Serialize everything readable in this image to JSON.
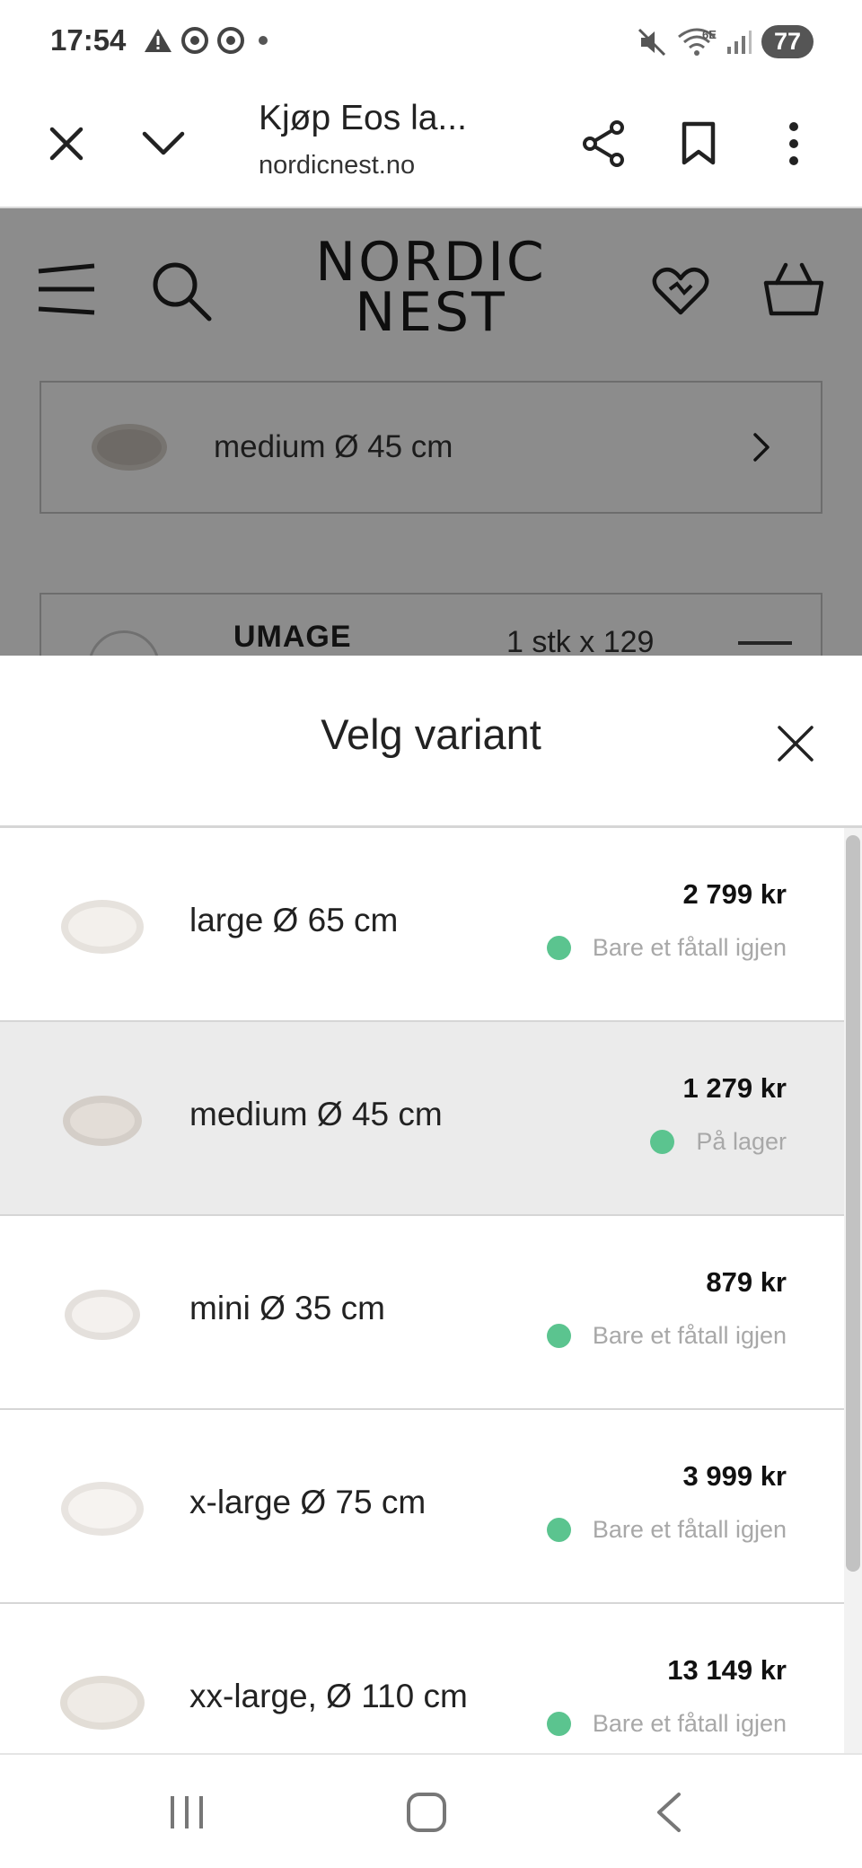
{
  "status_bar": {
    "time": "17:54",
    "battery": "77",
    "left_icons": [
      "warning-icon",
      "chrome-icon",
      "chrome-icon",
      "dot-icon"
    ],
    "right_icons": [
      "mute-icon",
      "wifi-icon",
      "signal-icon"
    ],
    "wifi_label": "6E"
  },
  "browser": {
    "tab_title": "Kjøp Eos la...",
    "url": "nordicnest.no",
    "icons": [
      "close-icon",
      "chevron-down-icon",
      "share-icon",
      "bookmark-icon",
      "more-vertical-icon"
    ]
  },
  "site": {
    "logo_line1": "NORDIC",
    "logo_line2": "NEST",
    "icons": [
      "menu-icon",
      "search-icon",
      "heart-icon",
      "basket-icon"
    ],
    "selected_variant": "medium Ø 45 cm",
    "cart_item": {
      "brand": "UMAGE",
      "qty": "1 stk x 129"
    }
  },
  "sheet": {
    "title": "Velg variant",
    "variants": [
      {
        "name": "large Ø 65 cm",
        "price": "2 799 kr",
        "stock": "Bare et fåtall igjen",
        "selected": false
      },
      {
        "name": "medium Ø 45 cm",
        "price": "1 279 kr",
        "stock": "På lager",
        "selected": true
      },
      {
        "name": "mini Ø 35 cm",
        "price": "879 kr",
        "stock": "Bare et fåtall igjen",
        "selected": false
      },
      {
        "name": "x-large Ø 75 cm",
        "price": "3 999 kr",
        "stock": "Bare et fåtall igjen",
        "selected": false
      },
      {
        "name": "xx-large, Ø 110 cm",
        "price": "13 149 kr",
        "stock": "Bare et fåtall igjen",
        "selected": false
      }
    ],
    "stock_color": "#5bc48f"
  },
  "nav": {
    "icons": [
      "recent-apps-icon",
      "home-icon",
      "back-icon"
    ]
  }
}
